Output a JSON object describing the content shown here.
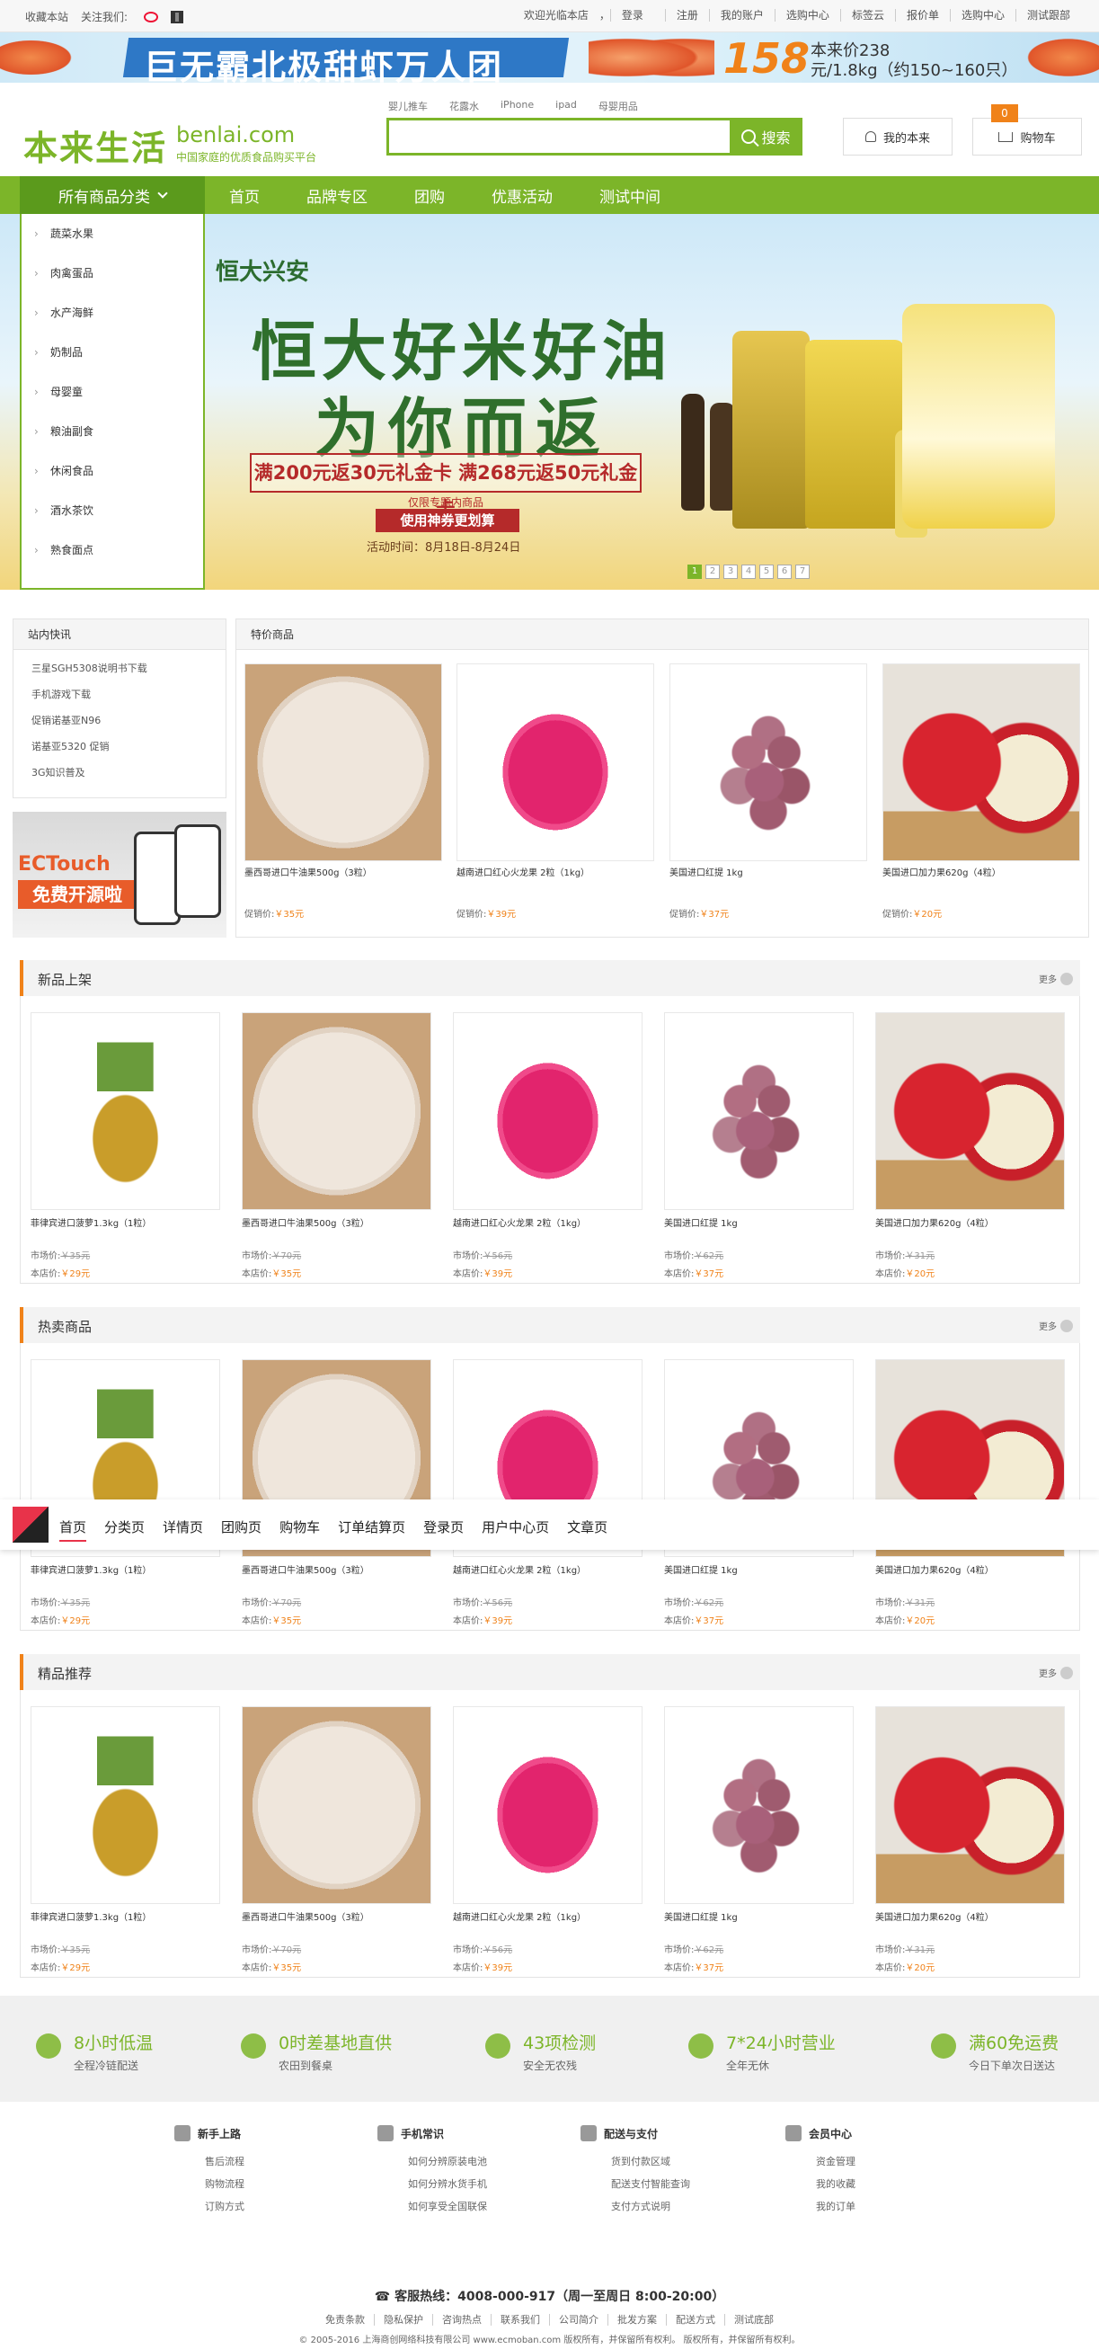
{
  "topbar": {
    "fav": "收藏本站",
    "follow": "关注我们:",
    "welcome": "欢迎光临本店",
    "login": "登录",
    "register": "注册",
    "account": "我的账户",
    "buycenter": "选购中心",
    "tags": "标签云",
    "quote": "报价单",
    "buycenter2": "选购中心",
    "test": "测试跟部"
  },
  "ad": {
    "title": "巨无霸北极甜虾万人团",
    "price": "158",
    "p1": "本来价238",
    "p2": "元/1.8kg（约150~160只）"
  },
  "header": {
    "logo": "本来生活",
    "logo_en": "benlai.com",
    "slogan": "中国家庭的优质食品购买平台",
    "hotwords": [
      "婴儿推车",
      "花露水",
      "iPhone",
      "ipad",
      "母婴用品"
    ],
    "search_btn": "搜索",
    "my": "我的本来",
    "cart": "购物车",
    "cart_count": "0"
  },
  "nav": {
    "all": "所有商品分类",
    "items": [
      "首页",
      "品牌专区",
      "团购",
      "优惠活动",
      "测试中间"
    ]
  },
  "categories": [
    "蔬菜水果",
    "肉禽蛋品",
    "水产海鲜",
    "奶制品",
    "母婴童",
    "粮油副食",
    "休闲食品",
    "酒水茶饮",
    "熟食面点"
  ],
  "hero": {
    "brand": "恒大兴安",
    "line1": "恒大好米好油",
    "line2": "为你而返",
    "offer": "满200元返30元礼金卡 满268元返50元礼金卡",
    "offer_note": "仅限专题内商品",
    "coupon": "使用神券更划算",
    "date": "活动时间：8月18日-8月24日",
    "dots": [
      "1",
      "2",
      "3",
      "4",
      "5",
      "6",
      "7"
    ]
  },
  "news": {
    "title": "站内快讯",
    "items": [
      "三星SGH5308说明书下载",
      "手机游戏下载",
      "促销诺基亚N96",
      "诺基亚5320 促销",
      "3G知识普及"
    ]
  },
  "ectouch": {
    "line1": "ECTouch",
    "line2": "免费开源啦"
  },
  "special": {
    "title": "特价商品",
    "label": "促销价:",
    "items": [
      {
        "name": "墨西哥进口牛油果500g（3粒）",
        "price": "￥35元",
        "img": "avocado"
      },
      {
        "name": "越南进口红心火龙果 2粒（1kg）",
        "price": "￥39元",
        "img": "dragon"
      },
      {
        "name": "美国进口红提 1kg",
        "price": "￥37元",
        "img": "grape"
      },
      {
        "name": "美国进口加力果620g（4粒）",
        "price": "￥20元",
        "img": "apple"
      }
    ]
  },
  "sections": [
    {
      "title": "新品上架",
      "more": "更多",
      "items": [
        {
          "name": "菲律宾进口菠萝1.3kg（1粒）",
          "market": "￥35元",
          "price": "￥29元",
          "img": "pineapple"
        },
        {
          "name": "墨西哥进口牛油果500g（3粒）",
          "market": "￥70元",
          "price": "￥35元",
          "img": "avocado"
        },
        {
          "name": "越南进口红心火龙果 2粒（1kg）",
          "market": "￥56元",
          "price": "￥39元",
          "img": "dragon"
        },
        {
          "name": "美国进口红提 1kg",
          "market": "￥62元",
          "price": "￥37元",
          "img": "grape"
        },
        {
          "name": "美国进口加力果620g（4粒）",
          "market": "￥31元",
          "price": "￥20元",
          "img": "apple"
        }
      ]
    },
    {
      "title": "热卖商品",
      "more": "更多",
      "items": [
        {
          "name": "菲律宾进口菠萝1.3kg（1粒）",
          "market": "￥35元",
          "price": "￥29元",
          "img": "pineapple"
        },
        {
          "name": "墨西哥进口牛油果500g（3粒）",
          "market": "￥70元",
          "price": "￥35元",
          "img": "avocado"
        },
        {
          "name": "越南进口红心火龙果 2粒（1kg）",
          "market": "￥56元",
          "price": "￥39元",
          "img": "dragon"
        },
        {
          "name": "美国进口红提 1kg",
          "market": "￥62元",
          "price": "￥37元",
          "img": "grape"
        },
        {
          "name": "美国进口加力果620g（4粒）",
          "market": "￥31元",
          "price": "￥20元",
          "img": "apple"
        }
      ]
    },
    {
      "title": "精品推荐",
      "more": "更多",
      "items": [
        {
          "name": "菲律宾进口菠萝1.3kg（1粒）",
          "market": "￥35元",
          "price": "￥29元",
          "img": "pineapple"
        },
        {
          "name": "墨西哥进口牛油果500g（3粒）",
          "market": "￥70元",
          "price": "￥35元",
          "img": "avocado"
        },
        {
          "name": "越南进口红心火龙果 2粒（1kg）",
          "market": "￥56元",
          "price": "￥39元",
          "img": "dragon"
        },
        {
          "name": "美国进口红提 1kg",
          "market": "￥62元",
          "price": "￥37元",
          "img": "grape"
        },
        {
          "name": "美国进口加力果620g（4粒）",
          "market": "￥31元",
          "price": "￥20元",
          "img": "apple"
        }
      ]
    }
  ],
  "labels": {
    "market": "市场价:",
    "ours": "本店价:"
  },
  "floatbar": {
    "links": [
      "首页",
      "分类页",
      "详情页",
      "团购页",
      "购物车",
      "订单结算页",
      "登录页",
      "用户中心页",
      "文章页"
    ]
  },
  "service": [
    {
      "t": "8小时低温",
      "s": "全程冷链配送"
    },
    {
      "t": "0时差基地直供",
      "s": "农田到餐桌"
    },
    {
      "t": "43项检测",
      "s": "安全无农残"
    },
    {
      "t": "7*24小时营业",
      "s": "全年无休"
    },
    {
      "t": "满60免运费",
      "s": "今日下单次日送达"
    }
  ],
  "help": [
    {
      "h": "新手上路",
      "l": [
        "售后流程",
        "购物流程",
        "订购方式"
      ]
    },
    {
      "h": "手机常识",
      "l": [
        "如何分辨原装电池",
        "如何分辨水货手机",
        "如何享受全国联保"
      ]
    },
    {
      "h": "配送与支付",
      "l": [
        "货到付款区域",
        "配送支付智能查询",
        "支付方式说明"
      ]
    },
    {
      "h": "会员中心",
      "l": [
        "资金管理",
        "我的收藏",
        "我的订单"
      ]
    }
  ],
  "footer": {
    "hotline": "客服热线：4008-000-917（周一至周日 8:00-20:00）",
    "links": [
      "免责条款",
      "隐私保护",
      "咨询热点",
      "联系我们",
      "公司简介",
      "批发方案",
      "配送方式",
      "测试底部"
    ],
    "copyright": "© 2005-2016 上海商创网络科技有限公司 www.ecmoban.com 版权所有，并保留所有权利。 版权所有，并保留所有权利。"
  }
}
